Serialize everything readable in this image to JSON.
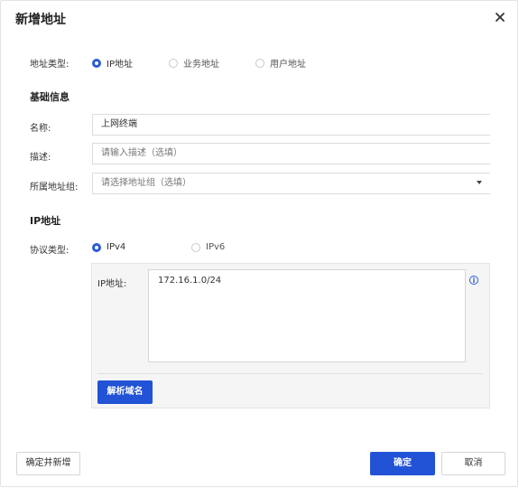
{
  "dialog": {
    "title": "新增地址"
  },
  "address_type": {
    "label": "地址类型:",
    "options": [
      "IP地址",
      "业务地址",
      "用户地址"
    ],
    "selected": "IP地址"
  },
  "basic_info": {
    "section_title": "基础信息",
    "name_label": "名称:",
    "name_value": "上网终端",
    "desc_label": "描述:",
    "desc_placeholder": "请输入描述（选填）",
    "group_label": "所属地址组:",
    "group_placeholder": "请选择地址组（选填）"
  },
  "ip_section": {
    "section_title": "IP地址",
    "protocol_label": "协议类型:",
    "protocol_options": [
      "IPv4",
      "IPv6"
    ],
    "protocol_selected": "IPv4",
    "ip_label": "IP地址:",
    "ip_value": "172.16.1.0/24",
    "resolve_button": "解析域名"
  },
  "footer": {
    "confirm_add_button": "确定并新增",
    "ok_button": "确定",
    "cancel_button": "取消"
  },
  "colors": {
    "primary": "#2253d6",
    "radio_selected": "#2a5bd7"
  }
}
